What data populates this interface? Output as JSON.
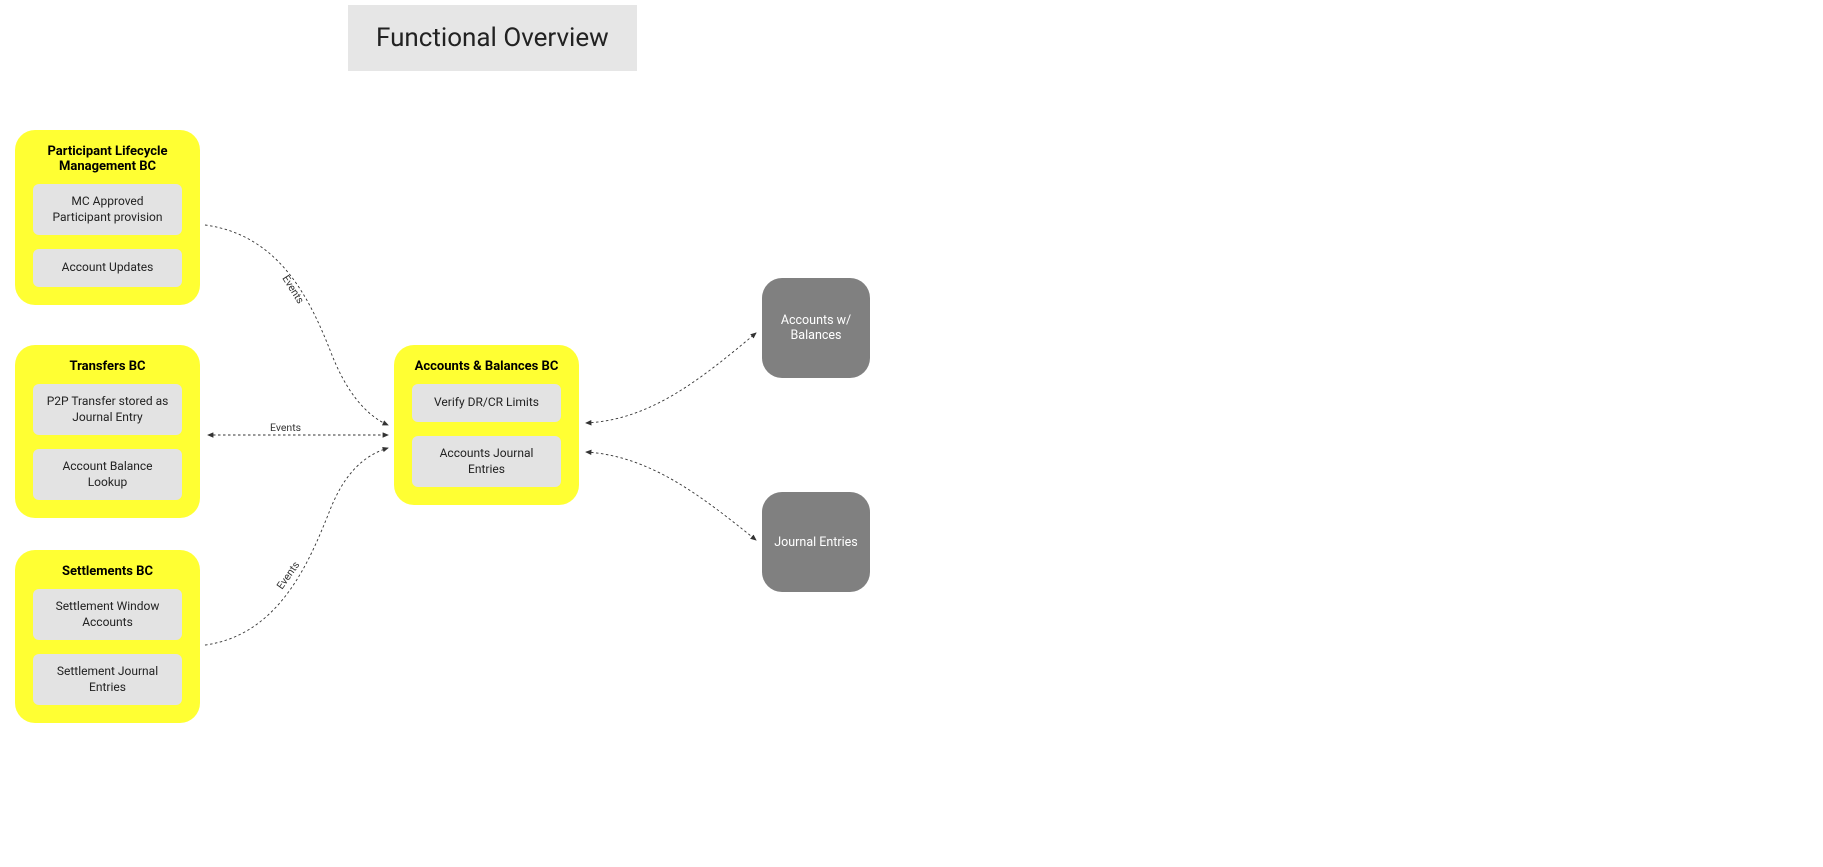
{
  "title": "Functional Overview",
  "boxes": {
    "plm": {
      "title": "Participant Lifecycle Management BC",
      "cards": [
        "MC Approved Participant provision",
        "Account Updates"
      ]
    },
    "transfers": {
      "title": "Transfers BC",
      "cards": [
        "P2P Transfer stored as Journal Entry",
        "Account Balance Lookup"
      ]
    },
    "settlements": {
      "title": "Settlements BC",
      "cards": [
        "Settlement Window Accounts",
        "Settlement Journal Entries"
      ]
    },
    "accounts": {
      "title": "Accounts & Balances BC",
      "cards": [
        "Verify DR/CR Limits",
        "Accounts Journal Entries"
      ]
    },
    "gray1": "Accounts w/ Balances",
    "gray2": "Journal Entries"
  },
  "edges": {
    "e1": "Events",
    "e2": "Events",
    "e3": "Events"
  }
}
